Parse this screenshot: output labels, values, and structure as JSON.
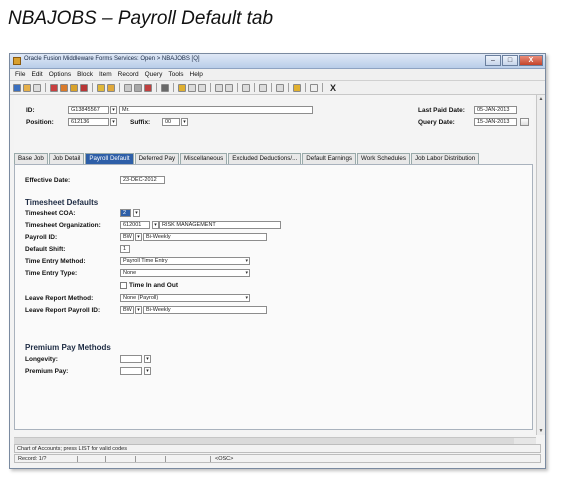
{
  "doc_title": "NBAJOBS – Payroll Default tab",
  "window": {
    "title": "Oracle Fusion Middleware Forms Services: Open > NBAJOBS [Q]",
    "buttons": {
      "minimize": "–",
      "maximize": "□",
      "close": "X"
    }
  },
  "menu": [
    "File",
    "Edit",
    "Options",
    "Block",
    "Item",
    "Record",
    "Query",
    "Tools",
    "Help"
  ],
  "toolbar": {
    "exit_label": "X"
  },
  "key_block": {
    "id_label": "ID:",
    "id_value": "G13845567",
    "name_value": "Mr.",
    "position_label": "Position:",
    "position_value": "612136",
    "suffix_label": "Suffix:",
    "suffix_value": "00",
    "last_paid_label": "Last Paid Date:",
    "last_paid_value": "05-JAN-2013",
    "query_date_label": "Query Date:",
    "query_date_value": "15-JAN-2013"
  },
  "tabs": [
    "Base Job",
    "Job Detail",
    "Payroll Default",
    "Deferred Pay",
    "Miscellaneous",
    "Excluded Deductions/...",
    "Default Earnings",
    "Work Schedules",
    "Job Labor Distribution"
  ],
  "form": {
    "effective_date_label": "Effective Date:",
    "effective_date_value": "23-DEC-2012",
    "timesheet_header": "Timesheet Defaults",
    "ts_coa_label": "Timesheet COA:",
    "ts_coa_value": "2",
    "ts_org_label": "Timesheet Organization:",
    "ts_org_code": "612001",
    "ts_org_desc": "RISK MANAGEMENT",
    "payroll_id_label": "Payroll ID:",
    "payroll_id_value": "BW",
    "payroll_id_desc": "Bi-Weekly",
    "default_shift_label": "Default Shift:",
    "default_shift_value": "1",
    "time_entry_method_label": "Time Entry Method:",
    "time_entry_method_value": "Payroll Time Entry",
    "time_entry_type_label": "Time Entry Type:",
    "time_entry_type_value": "None",
    "time_in_out_label": "Time In and Out",
    "leave_method_label": "Leave Report Method:",
    "leave_method_value": "None (Payroll)",
    "leave_payroll_label": "Leave Report Payroll ID:",
    "leave_payroll_value": "BW",
    "leave_payroll_desc": "Bi-Weekly",
    "premium_header": "Premium Pay Methods",
    "longevity_label": "Longevity:",
    "longevity_value": "",
    "premium_pay_label": "Premium Pay:",
    "premium_pay_value": ""
  },
  "status": {
    "hint": "Chart of Accounts; press LIST for valid codes",
    "record": "Record: 1/?",
    "osc": "<OSC>"
  }
}
